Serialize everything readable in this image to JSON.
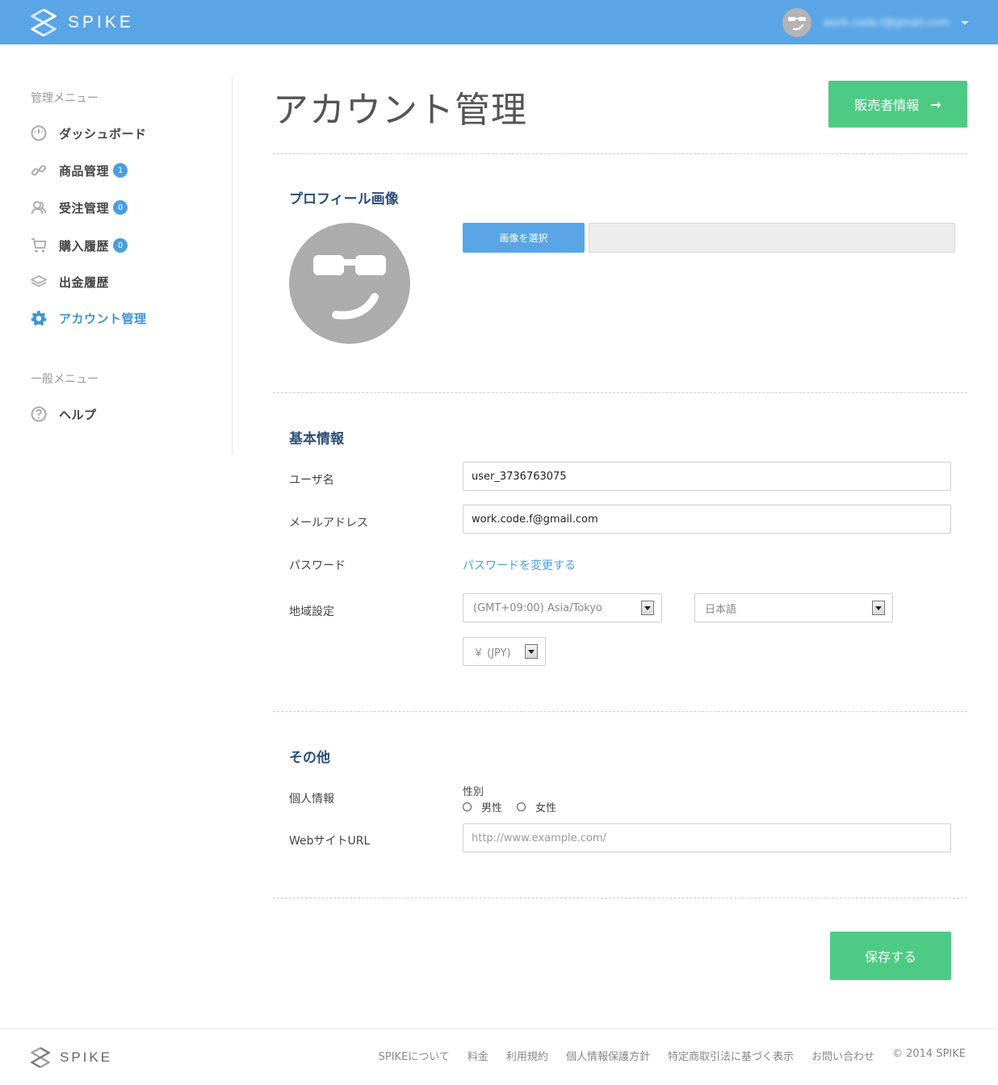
{
  "header": {
    "brand": "SPIKE",
    "user_email": "work.code.f@gmail.com"
  },
  "sidebar": {
    "admin_heading": "管理メニュー",
    "general_heading": "一般メニュー",
    "items": [
      {
        "label": "ダッシュボード",
        "icon": "dashboard-icon"
      },
      {
        "label": "商品管理",
        "icon": "link-icon",
        "badge": "1"
      },
      {
        "label": "受注管理",
        "icon": "users-icon",
        "badge": "0"
      },
      {
        "label": "購入履歴",
        "icon": "cart-icon",
        "badge": "0"
      },
      {
        "label": "出金履歴",
        "icon": "layers-icon"
      },
      {
        "label": "アカウント管理",
        "icon": "gear-icon",
        "active": true
      }
    ],
    "general_items": [
      {
        "label": "ヘルプ",
        "icon": "help-icon"
      }
    ]
  },
  "main": {
    "title": "アカウント管理",
    "seller_button": "販売者情報",
    "profile": {
      "title": "プロフィール画像",
      "choose_button": "画像を選択"
    },
    "basic": {
      "title": "基本情報",
      "username_label": "ユーザ名",
      "username_value": "user_3736763075",
      "email_label": "メールアドレス",
      "email_value": "work.code.f@gmail.com",
      "password_label": "パスワード",
      "password_link": "パスワードを変更する",
      "region_label": "地域設定",
      "timezone": "(GMT+09:00) Asia/Tokyo",
      "language": "日本語",
      "currency": "￥ (JPY)"
    },
    "other": {
      "title": "その他",
      "personal_label": "個人情報",
      "gender_label": "性別",
      "gender_male": "男性",
      "gender_female": "女性",
      "website_label": "WebサイトURL",
      "website_placeholder": "http://www.example.com/"
    },
    "save_button": "保存する"
  },
  "footer": {
    "brand": "SPIKE",
    "links": [
      "SPIKEについて",
      "料金",
      "利用規約",
      "個人情報保護方針",
      "特定商取引法に基づく表示",
      "お問い合わせ"
    ],
    "copyright": "© 2014 SPIKE"
  },
  "colors": {
    "header": "#5aa5e5",
    "accent_green": "#4dcb85",
    "link_blue": "#4a9ee0"
  }
}
